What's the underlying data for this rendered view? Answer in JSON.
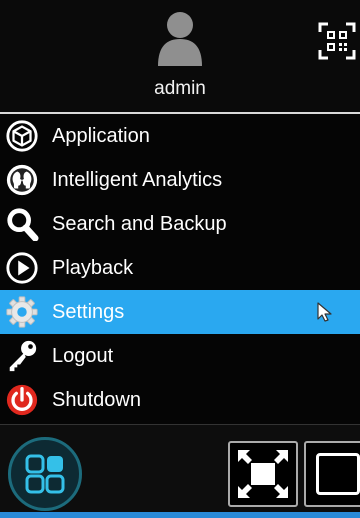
{
  "header": {
    "username": "admin",
    "avatar_icon": "user-avatar-icon",
    "qr_icon": "qr-code-icon"
  },
  "menu": {
    "selected_index": 4,
    "highlight_color": "#2aa8f0",
    "items": [
      {
        "label": "Application",
        "icon": "cube-icon"
      },
      {
        "label": "Intelligent Analytics",
        "icon": "face-analytics-icon"
      },
      {
        "label": "Search and Backup",
        "icon": "magnifier-icon"
      },
      {
        "label": "Playback",
        "icon": "play-circle-icon"
      },
      {
        "label": "Settings",
        "icon": "gear-icon"
      },
      {
        "label": "Logout",
        "icon": "key-icon"
      },
      {
        "label": "Shutdown",
        "icon": "power-icon"
      }
    ]
  },
  "footer": {
    "home_icon": "grid-home-icon",
    "fullscreen_icon": "fullscreen-icon",
    "window_icon": "window-icon",
    "accent_color": "#2a8ad8"
  }
}
